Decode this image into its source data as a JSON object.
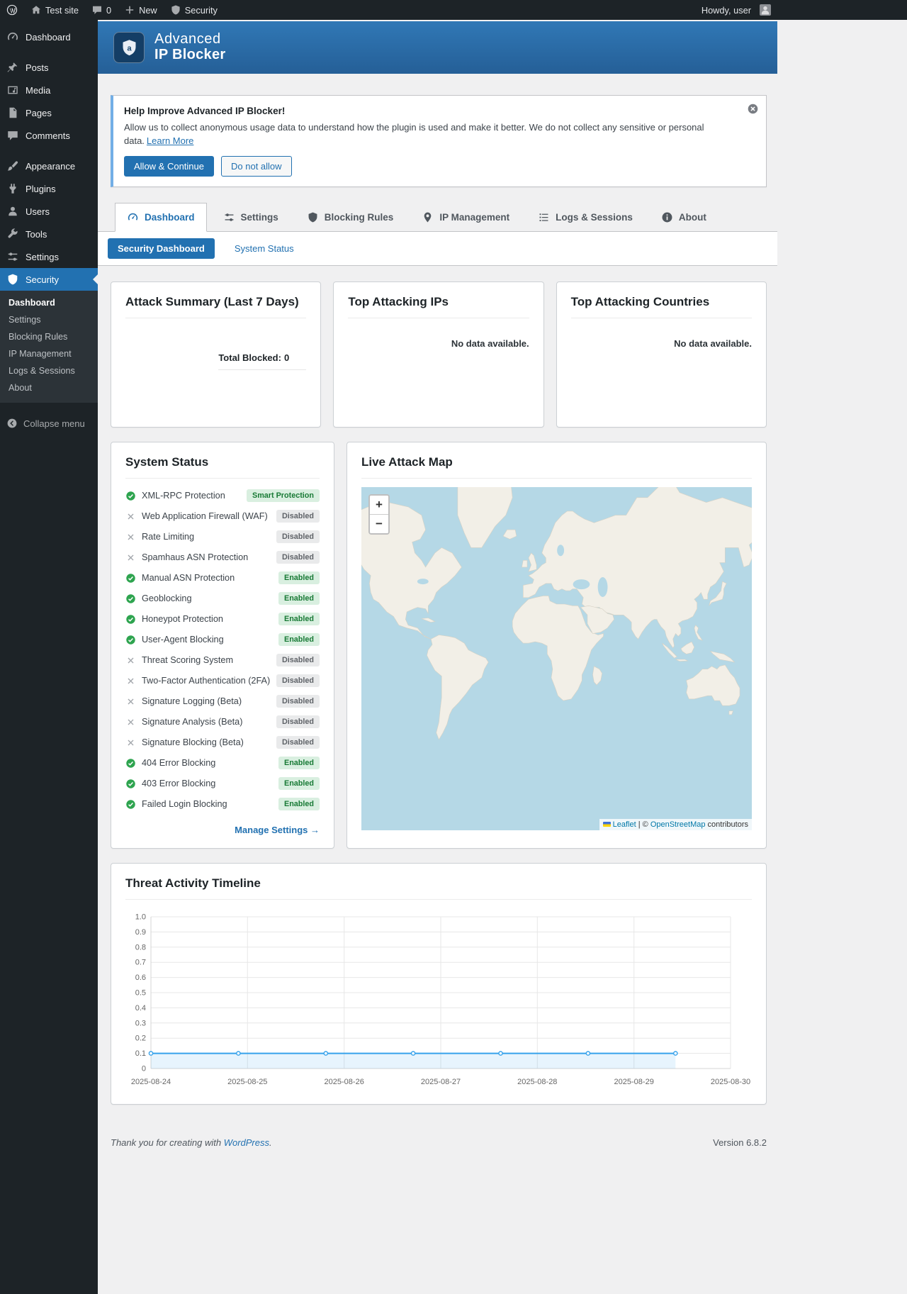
{
  "admin_bar": {
    "site_name": "Test site",
    "comments_count": "0",
    "new_label": "New",
    "security_label": "Security",
    "howdy": "Howdy, user"
  },
  "sidebar": {
    "items": [
      {
        "label": "Dashboard",
        "icon": "gauge",
        "active": false
      },
      {
        "label": "Posts",
        "icon": "pushpin",
        "active": false
      },
      {
        "label": "Media",
        "icon": "media",
        "active": false
      },
      {
        "label": "Pages",
        "icon": "pages",
        "active": false
      },
      {
        "label": "Comments",
        "icon": "comment",
        "active": false
      },
      {
        "label": "Appearance",
        "icon": "brush",
        "active": false
      },
      {
        "label": "Plugins",
        "icon": "plug",
        "active": false
      },
      {
        "label": "Users",
        "icon": "person",
        "active": false
      },
      {
        "label": "Tools",
        "icon": "wrench",
        "active": false
      },
      {
        "label": "Settings",
        "icon": "sliders",
        "active": false
      },
      {
        "label": "Security",
        "icon": "shield",
        "active": true
      }
    ],
    "submenu": [
      "Dashboard",
      "Settings",
      "Blocking Rules",
      "IP Management",
      "Logs & Sessions",
      "About"
    ],
    "submenu_active": "Dashboard",
    "collapse_label": "Collapse menu"
  },
  "banner": {
    "title_line1": "Advanced",
    "title_line2": "IP Blocker"
  },
  "notice": {
    "title": "Help Improve Advanced IP Blocker!",
    "body": "Allow us to collect anonymous usage data to understand how the plugin is used and make it better. We do not collect any sensitive or personal data.",
    "link": "Learn More",
    "allow_button": "Allow & Continue",
    "deny_button": "Do not allow"
  },
  "tabs": [
    {
      "label": "Dashboard",
      "icon": "gauge",
      "active": true
    },
    {
      "label": "Settings",
      "icon": "sliders",
      "active": false
    },
    {
      "label": "Blocking Rules",
      "icon": "shield",
      "active": false
    },
    {
      "label": "IP Management",
      "icon": "location",
      "active": false
    },
    {
      "label": "Logs & Sessions",
      "icon": "list",
      "active": false
    },
    {
      "label": "About",
      "icon": "info",
      "active": false
    }
  ],
  "subnav": {
    "active": "Security Dashboard",
    "other": "System Status"
  },
  "cards": {
    "attack_summary": {
      "title": "Attack Summary (Last 7 Days)",
      "total_label": "Total Blocked:",
      "total_value": "0"
    },
    "top_ips": {
      "title": "Top Attacking IPs",
      "empty": "No data available."
    },
    "top_countries": {
      "title": "Top Attacking Countries",
      "empty": "No data available."
    }
  },
  "system_status": {
    "title": "System Status",
    "items": [
      {
        "label": "XML-RPC Protection",
        "status": "Smart Protection",
        "state": "on"
      },
      {
        "label": "Web Application Firewall (WAF)",
        "status": "Disabled",
        "state": "off"
      },
      {
        "label": "Rate Limiting",
        "status": "Disabled",
        "state": "off"
      },
      {
        "label": "Spamhaus ASN Protection",
        "status": "Disabled",
        "state": "off"
      },
      {
        "label": "Manual ASN Protection",
        "status": "Enabled",
        "state": "on"
      },
      {
        "label": "Geoblocking",
        "status": "Enabled",
        "state": "on"
      },
      {
        "label": "Honeypot Protection",
        "status": "Enabled",
        "state": "on"
      },
      {
        "label": "User-Agent Blocking",
        "status": "Enabled",
        "state": "on"
      },
      {
        "label": "Threat Scoring System",
        "status": "Disabled",
        "state": "off"
      },
      {
        "label": "Two-Factor Authentication (2FA)",
        "status": "Disabled",
        "state": "off"
      },
      {
        "label": "Signature Logging (Beta)",
        "status": "Disabled",
        "state": "off"
      },
      {
        "label": "Signature Analysis (Beta)",
        "status": "Disabled",
        "state": "off"
      },
      {
        "label": "Signature Blocking (Beta)",
        "status": "Disabled",
        "state": "off"
      },
      {
        "label": "404 Error Blocking",
        "status": "Enabled",
        "state": "on"
      },
      {
        "label": "403 Error Blocking",
        "status": "Enabled",
        "state": "on"
      },
      {
        "label": "Failed Login Blocking",
        "status": "Enabled",
        "state": "on"
      }
    ],
    "manage_link": "Manage Settings →"
  },
  "map": {
    "title": "Live Attack Map",
    "zoom_in": "+",
    "zoom_out": "−",
    "attr_leaflet": "Leaflet",
    "attr_mid": " | © ",
    "attr_osm": "OpenStreetMap",
    "attr_suffix": " contributors"
  },
  "chart_data": {
    "type": "line",
    "title": "Threat Activity Timeline",
    "categories": [
      "2025-08-24",
      "2025-08-25",
      "2025-08-26",
      "2025-08-27",
      "2025-08-28",
      "2025-08-29",
      "2025-08-30"
    ],
    "series": [
      {
        "name": "Threat Activity",
        "values": [
          0.1,
          0.1,
          0.1,
          0.1,
          0.1,
          0.1,
          0.1
        ]
      }
    ],
    "ylim": [
      0,
      1.0
    ],
    "ytick_step": 0.1,
    "grid": true,
    "legend": false,
    "line_color": "#36a2eb",
    "fill_color": "rgba(54,162,235,0.12)"
  },
  "footer": {
    "thanks_prefix": "Thank you for creating with ",
    "thanks_link": "WordPress",
    "thanks_suffix": ".",
    "version": "Version 6.8.2"
  },
  "colors": {
    "accent": "#2271b1",
    "banner_blue": "#2b6fae",
    "badge_on_text": "#187a35",
    "badge_off_text": "#5f6368",
    "map_water": "#b5d8e6",
    "map_land": "#f2efe7"
  }
}
